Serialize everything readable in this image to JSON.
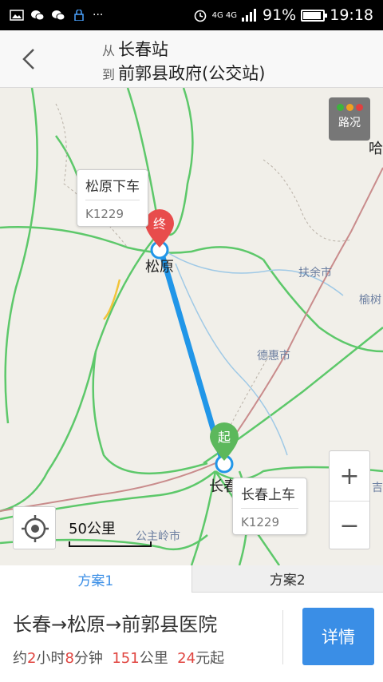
{
  "status_bar": {
    "network": "4G 4G",
    "battery": "91%",
    "battery_level": 0.91,
    "time": "19:18",
    "icons": [
      "image-icon",
      "wechat-icon",
      "wechat-icon",
      "vpn-icon",
      "more-icon",
      "alarm-icon",
      "signal-icon",
      "battery-icon"
    ]
  },
  "header": {
    "from_prefix": "从",
    "from_name": "长春站",
    "to_prefix": "到",
    "to_name": "前郭县政府(公交站)"
  },
  "map": {
    "traffic_label": "路况",
    "traffic_colors": [
      "#3cb43c",
      "#f0a020",
      "#e04040"
    ],
    "route_color": "#2196e8",
    "end_marker": "终",
    "start_marker": "起",
    "end_callout": {
      "title": "松原下车",
      "train": "K1229"
    },
    "start_callout": {
      "title": "长春上车",
      "train": "K1229"
    },
    "cities": {
      "songyuan": "松原",
      "changchun": "长春",
      "fuyu": "扶余市",
      "dehui": "德惠市",
      "yushu": "榆树",
      "gongzhuling": "公主岭市",
      "ha": "哈",
      "ji": "吉"
    },
    "zoom_in": "+",
    "zoom_out": "−",
    "scale_label": "50公里"
  },
  "tabs": [
    {
      "label": "方案1",
      "active": true
    },
    {
      "label": "方案2",
      "active": false
    }
  ],
  "plan": {
    "title": "长春→松原→前郭县医院",
    "info_prefix": "约",
    "hours": "2",
    "hours_unit": "小时",
    "minutes": "8",
    "minutes_unit": "分钟",
    "distance": "151",
    "distance_unit": "公里",
    "price": "24",
    "price_unit": "元起",
    "detail_button": "详情"
  }
}
